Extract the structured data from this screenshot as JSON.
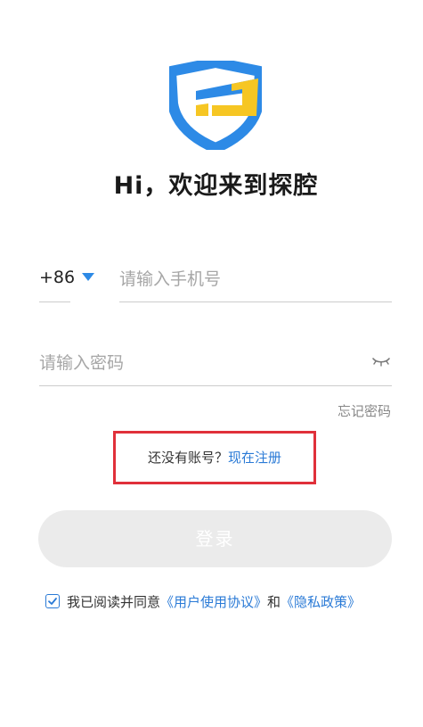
{
  "app": {
    "welcome_title": "Hi，欢迎来到探腔"
  },
  "brand": {
    "colors": {
      "primary_blue": "#2d8ae6",
      "accent_yellow": "#f6c623",
      "link_blue": "#2a7ad6",
      "highlight_red": "#e0303a"
    },
    "logo_icon": "shield-logo-icon"
  },
  "login_form": {
    "country_code": "+86",
    "country_dropdown_icon": "caret-down-icon",
    "phone": {
      "value": "",
      "placeholder": "请输入手机号"
    },
    "password": {
      "value": "",
      "placeholder": "请输入密码",
      "visibility_icon": "eye-closed-icon"
    },
    "forgot_password_label": "忘记密码",
    "register_prompt": "还没有账号？",
    "register_link_label": "现在注册",
    "login_button_label": "登录"
  },
  "agreement": {
    "checked": true,
    "checkbox_icon": "checkmark-icon",
    "prefix_text": "我已阅读并同意",
    "user_agreement_label": "《用户使用协议》",
    "conjunction_text": "和",
    "privacy_policy_label": "《隐私政策》"
  }
}
